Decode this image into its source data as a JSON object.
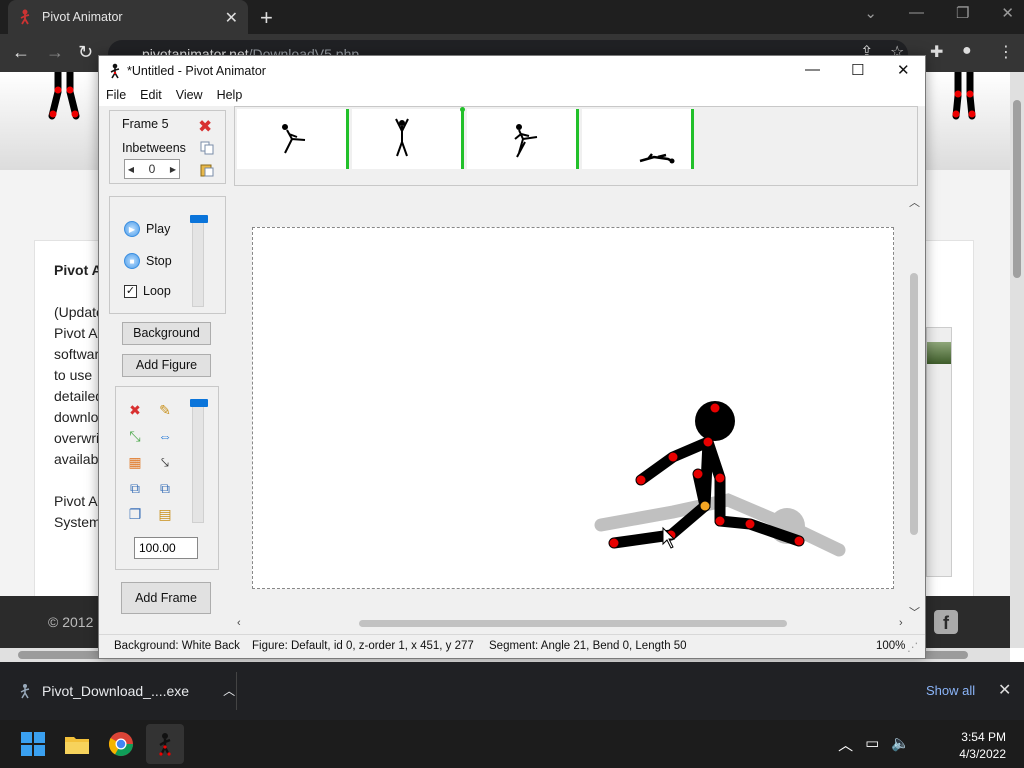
{
  "browser": {
    "tab_title": "Pivot Animator",
    "tab_close": "✕",
    "new_tab": "+",
    "url_host": "pivotanimator.net",
    "url_path": "/DownloadV5.php"
  },
  "webpage": {
    "heading": "Pivot A",
    "para1": [
      "(Update",
      "Pivot A",
      "softwar",
      "to use",
      "detailed",
      "downlo",
      "overwri",
      "availab"
    ],
    "para2": [
      "Pivot A",
      "System"
    ],
    "footer_copy": "© 2012",
    "facebook_glyph": "f"
  },
  "app": {
    "title": "*Untitled - Pivot Animator",
    "menu": [
      "File",
      "Edit",
      "View",
      "Help"
    ],
    "frame_label": "Frame 5",
    "inbetweens_label": "Inbetweens",
    "inbetweens_value": "0",
    "play_label": "Play",
    "stop_label": "Stop",
    "loop_label": "Loop",
    "loop_checked": "✓",
    "background_button": "Background",
    "add_figure_button": "Add Figure",
    "zoom_value": "100.00",
    "add_frame_button": "Add Frame",
    "status": {
      "background": "Background: White Back",
      "figure": "Figure: Default,  id 0,  z-order 1,  x 451, y 277",
      "segment": "Segment: Angle 21,  Bend 0,  Length 50",
      "zoom": "100%"
    },
    "colors": {
      "frame_separator": "#22c02a",
      "joint": "#e80000",
      "origin_joint": "#f5a623",
      "shadow": "#c0c0c0"
    }
  },
  "downloads": {
    "file_name": "Pivot_Download_....exe",
    "show_all": "Show all"
  },
  "taskbar": {
    "time": "3:54 PM",
    "date": "4/3/2022"
  }
}
